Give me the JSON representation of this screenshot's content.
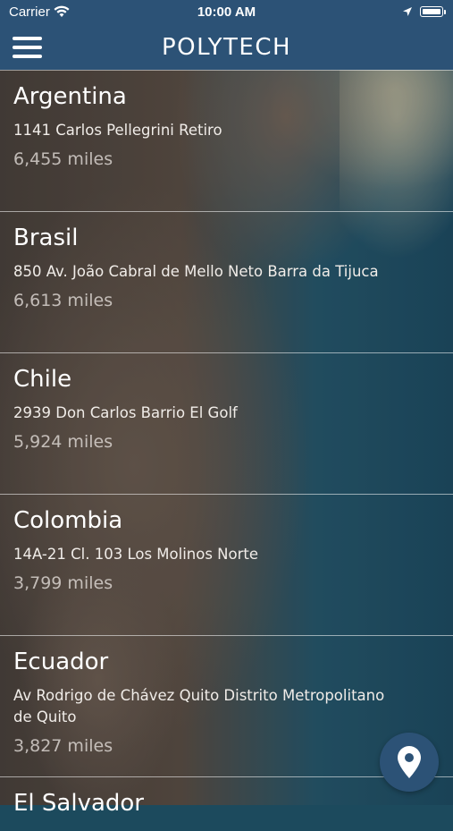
{
  "status_bar": {
    "carrier": "Carrier",
    "time": "10:00 AM"
  },
  "header": {
    "title": "POLYTECH",
    "menu_icon": "hamburger-menu-icon",
    "color": "#2c5276"
  },
  "locations": [
    {
      "country": "Argentina",
      "address": "1141 Carlos Pellegrini Retiro",
      "distance": "6,455 miles"
    },
    {
      "country": "Brasil",
      "address": "850 Av. João Cabral de Mello Neto Barra da Tijuca",
      "distance": "6,613 miles"
    },
    {
      "country": "Chile",
      "address": "2939 Don Carlos Barrio El Golf",
      "distance": "5,924 miles"
    },
    {
      "country": "Colombia",
      "address": "14A-21 Cl. 103 Los Molinos Norte",
      "distance": "3,799 miles"
    },
    {
      "country": "Ecuador",
      "address": "Av Rodrigo de Chávez Quito Distrito Metropolitano de Quito",
      "distance": "3,827 miles"
    },
    {
      "country": "El Salvador"
    }
  ],
  "map_button": {
    "icon": "map-pin-icon"
  }
}
